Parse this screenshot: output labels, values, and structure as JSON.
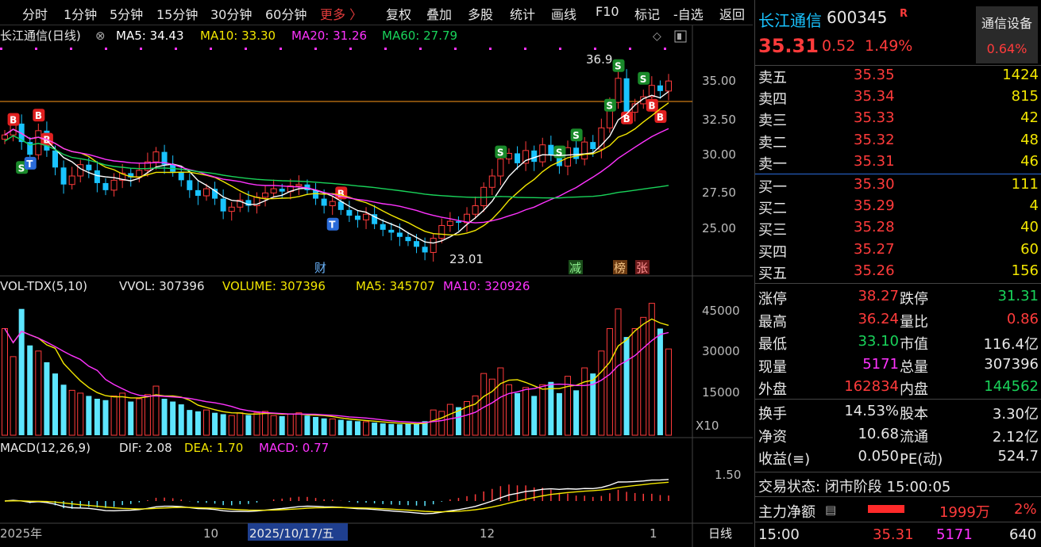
{
  "toolbar": {
    "intervals": [
      "分时",
      "1分钟",
      "5分钟",
      "15分钟",
      "30分钟",
      "60分钟"
    ],
    "more": "更多 〉",
    "actions": [
      "复权",
      "叠加",
      "多股",
      "统计",
      "画线",
      "F10",
      "标记",
      "-自选",
      "返回"
    ]
  },
  "main_chart": {
    "title": "长江通信(日线)",
    "ma5_label": "MA5: 34.43",
    "ma10_label": "MA10: 33.30",
    "ma20_label": "MA20: 31.26",
    "ma60_label": "MA60: 27.79",
    "high_annot": "36.9",
    "low_annot": "23.01",
    "event_labels": [
      "财",
      "减",
      "榜",
      "张"
    ],
    "price_ticks": [
      "35.00",
      "32.50",
      "30.00",
      "27.50",
      "25.00"
    ]
  },
  "volume_chart": {
    "title": "VOL-TDX(5,10)",
    "vvol_label": "VVOL: 307396",
    "volume_label": "VOLUME: 307396",
    "ma5_label": "MA5: 345707",
    "ma10_label": "MA10: 320926",
    "ticks": [
      "45000",
      "30000",
      "15000"
    ],
    "unit": "X10"
  },
  "macd_chart": {
    "title": "MACD(12,26,9)",
    "dif_label": "DIF: 2.08",
    "dea_label": "DEA: 1.70",
    "macd_label": "MACD: 0.77",
    "tick": "1.50"
  },
  "x_axis": {
    "labels": [
      "2025年",
      "10",
      "2025/10/17/五",
      "12",
      "1"
    ],
    "period": "日线"
  },
  "quote": {
    "name": "长江通信",
    "code": "600345",
    "flag": "R",
    "sector": "通信设备",
    "sector_change": "0.64%",
    "price": "35.31",
    "change": "0.52",
    "change_pct": "1.49%",
    "asks": [
      {
        "label": "卖五",
        "price": "35.35",
        "vol": "1424"
      },
      {
        "label": "卖四",
        "price": "35.34",
        "vol": "815"
      },
      {
        "label": "卖三",
        "price": "35.33",
        "vol": "42"
      },
      {
        "label": "卖二",
        "price": "35.32",
        "vol": "48"
      },
      {
        "label": "卖一",
        "price": "35.31",
        "vol": "46"
      }
    ],
    "bids": [
      {
        "label": "买一",
        "price": "35.30",
        "vol": "111"
      },
      {
        "label": "买二",
        "price": "35.29",
        "vol": "4"
      },
      {
        "label": "买三",
        "price": "35.28",
        "vol": "40"
      },
      {
        "label": "买四",
        "price": "35.27",
        "vol": "60"
      },
      {
        "label": "买五",
        "price": "35.26",
        "vol": "156"
      }
    ],
    "stats1": [
      {
        "k1": "涨停",
        "v1": "38.27",
        "k2": "跌停",
        "v2": "31.31"
      },
      {
        "k1": "最高",
        "v1": "36.24",
        "k2": "量比",
        "v2": "0.86"
      },
      {
        "k1": "最低",
        "v1": "33.10",
        "k2": "市值",
        "v2": "116.4亿"
      },
      {
        "k1": "现量",
        "v1": "5171",
        "k2": "总量",
        "v2": "307396"
      },
      {
        "k1": "外盘",
        "v1": "162834",
        "k2": "内盘",
        "v2": "144562"
      }
    ],
    "stats2": [
      {
        "k1": "换手",
        "v1": "14.53%",
        "k2": "股本",
        "v2": "3.30亿"
      },
      {
        "k1": "净资",
        "v1": "10.68",
        "k2": "流通",
        "v2": "2.12亿"
      },
      {
        "k1": "收益(≡)",
        "v1": "0.050",
        "k2": "PE(动)",
        "v2": "524.7"
      }
    ],
    "status": "交易状态: 闭市阶段 15:00:05",
    "main_flow_label": "主力净额",
    "main_flow_value": "1999万",
    "main_flow_pct": "2%",
    "last_tick": {
      "time": "15:00",
      "price": "35.31",
      "vol": "5171",
      "extra": "640"
    }
  },
  "colors": {
    "up": "#ff3b3b",
    "down": "#19c3ff",
    "ma5": "#ffffff",
    "ma10": "#f2e600",
    "ma20": "#ff33ff",
    "ma60": "#19d35a"
  },
  "chart_data": {
    "type": "candlestick",
    "price_axis": [
      23,
      37
    ],
    "candles_close": [
      31.5,
      32.3,
      31.0,
      30.1,
      31.8,
      30.4,
      29.2,
      28.0,
      28.6,
      29.4,
      29.0,
      28.1,
      27.6,
      28.3,
      28.8,
      28.5,
      29.0,
      29.6,
      30.3,
      29.4,
      28.9,
      28.3,
      27.6,
      27.2,
      27.7,
      27.0,
      26.1,
      26.4,
      26.9,
      26.5,
      27.1,
      27.4,
      27.7,
      27.5,
      27.9,
      28.0,
      27.6,
      27.0,
      26.5,
      26.8,
      26.2,
      25.8,
      25.5,
      25.9,
      25.2,
      24.8,
      24.6,
      24.3,
      24.0,
      23.6,
      23.2,
      24.2,
      25.1,
      25.4,
      25.3,
      25.9,
      26.5,
      27.8,
      28.6,
      29.8,
      30.2,
      29.5,
      30.4,
      29.6,
      30.8,
      30.1,
      29.3,
      30.6,
      29.8,
      31.0,
      30.5,
      32.0,
      33.8,
      35.5,
      33.1,
      33.7,
      34.2,
      35.0,
      34.6,
      35.31
    ],
    "volume": [
      38000,
      28000,
      45000,
      32000,
      30000,
      26000,
      22000,
      18000,
      16000,
      15000,
      14000,
      13000,
      12500,
      14000,
      15000,
      12000,
      13000,
      14500,
      17500,
      13000,
      12000,
      11000,
      9000,
      8500,
      9000,
      8000,
      7500,
      7000,
      8000,
      7200,
      8000,
      8500,
      7000,
      6800,
      7500,
      8000,
      7000,
      6500,
      6000,
      5800,
      5500,
      5200,
      5000,
      4800,
      4500,
      4200,
      4000,
      3900,
      4200,
      4100,
      5000,
      9000,
      8500,
      11000,
      10000,
      12000,
      14000,
      22000,
      20000,
      24000,
      18000,
      15000,
      17000,
      14000,
      18000,
      19000,
      15000,
      21000,
      16000,
      24000,
      22000,
      30000,
      38000,
      45000,
      35000,
      38000,
      42000,
      47000,
      38000,
      30739
    ]
  }
}
